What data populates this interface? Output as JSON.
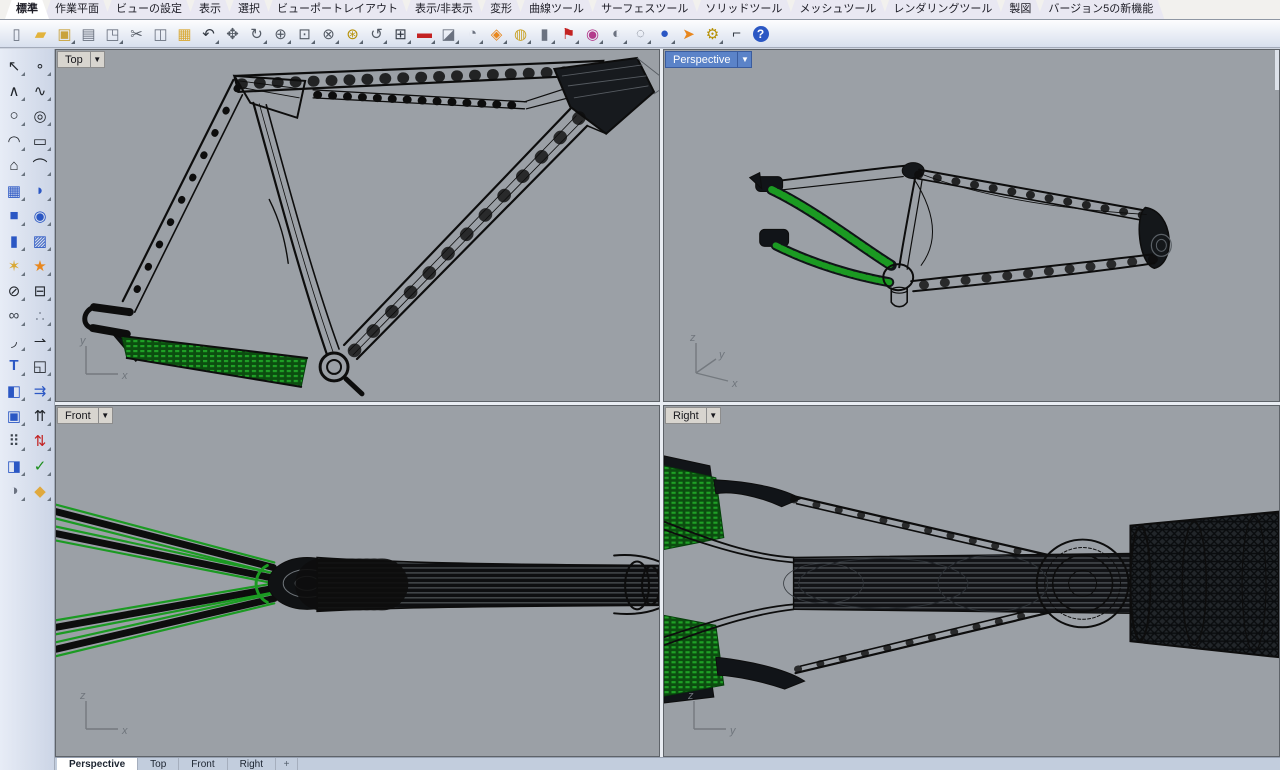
{
  "app": {
    "name_hint": "Rhinoceros 4-viewport modeling window"
  },
  "colors": {
    "viewport_bg": "#9ba0a6",
    "wireframe": "#0d0d0d",
    "selection_green": "#1b9a22",
    "selection_green_dark": "#0c4d10",
    "active_label_bg": "#5b83c8",
    "inactive_label_bg": "#d8d5cf",
    "toolbar_bg": "#d8e0ee"
  },
  "menu_tabs": {
    "items": [
      {
        "name": "standard",
        "label": "標準",
        "active": true
      },
      {
        "name": "cplane",
        "label": "作業平面",
        "active": false
      },
      {
        "name": "view-settings",
        "label": "ビューの設定",
        "active": false
      },
      {
        "name": "display",
        "label": "表示",
        "active": false
      },
      {
        "name": "select",
        "label": "選択",
        "active": false
      },
      {
        "name": "viewport-layout",
        "label": "ビューポートレイアウト",
        "active": false
      },
      {
        "name": "visibility",
        "label": "表示/非表示",
        "active": false
      },
      {
        "name": "transform",
        "label": "変形",
        "active": false
      },
      {
        "name": "curve-tools",
        "label": "曲線ツール",
        "active": false
      },
      {
        "name": "surface-tools",
        "label": "サーフェスツール",
        "active": false
      },
      {
        "name": "solid-tools",
        "label": "ソリッドツール",
        "active": false
      },
      {
        "name": "mesh-tools",
        "label": "メッシュツール",
        "active": false
      },
      {
        "name": "render-tools",
        "label": "レンダリングツール",
        "active": false
      },
      {
        "name": "drafting",
        "label": "製図",
        "active": false
      },
      {
        "name": "v5-new-features",
        "label": "バージョン5の新機能",
        "active": false
      }
    ]
  },
  "toolbar": {
    "icons": [
      {
        "name": "new-file-icon",
        "glyph": "▯",
        "color": "#6b7280",
        "fly": false
      },
      {
        "name": "open-file-icon",
        "glyph": "▰",
        "color": "#e2b33c",
        "fly": false
      },
      {
        "name": "save-icon",
        "glyph": "▣",
        "color": "#c9a23a",
        "fly": true
      },
      {
        "name": "print-icon",
        "glyph": "▤",
        "color": "#6b7280",
        "fly": false
      },
      {
        "name": "export-file-icon",
        "glyph": "◳",
        "color": "#6b7280",
        "fly": true
      },
      {
        "name": "cut-icon",
        "glyph": "✂",
        "color": "#555c66",
        "fly": false
      },
      {
        "name": "copy-icon",
        "glyph": "◫",
        "color": "#6b7280",
        "fly": false
      },
      {
        "name": "paste-icon",
        "glyph": "▦",
        "color": "#d9a832",
        "fly": false
      },
      {
        "name": "undo-icon",
        "glyph": "↶",
        "color": "#333a44",
        "fly": true
      },
      {
        "name": "pan-icon",
        "glyph": "✥",
        "color": "#555c66",
        "fly": false
      },
      {
        "name": "rotate-view-icon",
        "glyph": "↻",
        "color": "#555c66",
        "fly": true
      },
      {
        "name": "zoom-in-icon",
        "glyph": "⊕",
        "color": "#555c66",
        "fly": true
      },
      {
        "name": "zoom-window-icon",
        "glyph": "⊡",
        "color": "#555c66",
        "fly": true
      },
      {
        "name": "zoom-extents-icon",
        "glyph": "⊗",
        "color": "#555c66",
        "fly": true
      },
      {
        "name": "zoom-selected-icon",
        "glyph": "⊛",
        "color": "#b58f00",
        "fly": true
      },
      {
        "name": "undo-view-icon",
        "glyph": "↺",
        "color": "#555c66",
        "fly": true
      },
      {
        "name": "viewport-layout-icon",
        "glyph": "⊞",
        "color": "#333a44",
        "fly": true
      },
      {
        "name": "car-icon",
        "glyph": "▬",
        "color": "#c32222",
        "fly": true
      },
      {
        "name": "map-icon",
        "glyph": "◪",
        "color": "#6b7280",
        "fly": true
      },
      {
        "name": "dial-icon",
        "glyph": "◔",
        "color": "#6b7280",
        "fly": true
      },
      {
        "name": "osnap-icon",
        "glyph": "◈",
        "color": "#e8871e",
        "fly": true
      },
      {
        "name": "lightbulb-icon",
        "glyph": "◍",
        "color": "#c9a227",
        "fly": true
      },
      {
        "name": "lock-icon",
        "glyph": "▮",
        "color": "#6b7280",
        "fly": true
      },
      {
        "name": "pennant-icon",
        "glyph": "⚑",
        "color": "#c32222",
        "fly": true
      },
      {
        "name": "color-wheel-icon",
        "glyph": "◉",
        "color": "#b33b8c",
        "fly": true
      },
      {
        "name": "shaded-sphere-icon",
        "glyph": "◐",
        "color": "#6b7280",
        "fly": true
      },
      {
        "name": "ghosted-sphere-icon",
        "glyph": "◌",
        "color": "#6b7280",
        "fly": true
      },
      {
        "name": "rendered-sphere-icon",
        "glyph": "●",
        "color": "#2b57c4",
        "fly": true
      },
      {
        "name": "cone-icon",
        "glyph": "➤",
        "color": "#e8871e",
        "fly": false
      },
      {
        "name": "gears-icon",
        "glyph": "⚙",
        "color": "#b58f00",
        "fly": true
      },
      {
        "name": "history-icon",
        "glyph": "⌐",
        "color": "#333a44",
        "fly": false
      },
      {
        "name": "help-icon",
        "glyph": "?",
        "color": "#ffffff",
        "fly": false,
        "round": true
      }
    ]
  },
  "sidebar": {
    "icons": [
      {
        "name": "select-arrow-icon",
        "glyph": "↖",
        "color": "#22262c"
      },
      {
        "name": "point-icon",
        "glyph": "∘",
        "color": "#22262c"
      },
      {
        "name": "polyline-icon",
        "glyph": "∧",
        "color": "#22262c"
      },
      {
        "name": "curve-icon",
        "glyph": "∿",
        "color": "#22262c"
      },
      {
        "name": "circle-icon",
        "glyph": "○",
        "color": "#22262c"
      },
      {
        "name": "ellipse-icon",
        "glyph": "◎",
        "color": "#22262c"
      },
      {
        "name": "arc-icon",
        "glyph": "◠",
        "color": "#22262c"
      },
      {
        "name": "rectangle-icon",
        "glyph": "▭",
        "color": "#22262c"
      },
      {
        "name": "polygon-icon",
        "glyph": "⌂",
        "color": "#22262c"
      },
      {
        "name": "handle-curve-icon",
        "glyph": "⌒",
        "color": "#22262c"
      },
      {
        "name": "surface-points-icon",
        "glyph": "▦",
        "color": "#2b57c4"
      },
      {
        "name": "curved-surface-icon",
        "glyph": "◗",
        "color": "#2b57c4"
      },
      {
        "name": "box-icon",
        "glyph": "■",
        "color": "#2b57c4"
      },
      {
        "name": "spheres-icon",
        "glyph": "◉",
        "color": "#2b57c4"
      },
      {
        "name": "cylinder-icon",
        "glyph": "▮",
        "color": "#2b57c4"
      },
      {
        "name": "mesh-plane-icon",
        "glyph": "▨",
        "color": "#2b57c4"
      },
      {
        "name": "boolean-union-icon",
        "glyph": "✶",
        "color": "#d9a832"
      },
      {
        "name": "explode-icon",
        "glyph": "★",
        "color": "#e8871e"
      },
      {
        "name": "trim-icon",
        "glyph": "⊘",
        "color": "#22262c"
      },
      {
        "name": "split-icon",
        "glyph": "⊟",
        "color": "#22262c"
      },
      {
        "name": "join-icon",
        "glyph": "∞",
        "color": "#3c434c"
      },
      {
        "name": "group-icon",
        "glyph": "∴",
        "color": "#8a93a3"
      },
      {
        "name": "fillet-curve-icon",
        "glyph": "◞",
        "color": "#22262c"
      },
      {
        "name": "extend-curve-icon",
        "glyph": "⇀",
        "color": "#22262c"
      },
      {
        "name": "text-icon",
        "glyph": "T",
        "color": "#2b57c4",
        "bold": true
      },
      {
        "name": "point-edit-icon",
        "glyph": "◱",
        "color": "#22262c"
      },
      {
        "name": "blocks-icon",
        "glyph": "◧",
        "color": "#2b57c4"
      },
      {
        "name": "offset-icon",
        "glyph": "⇉",
        "color": "#2b57c4"
      },
      {
        "name": "solid-box-icon",
        "glyph": "▣",
        "color": "#2b57c4"
      },
      {
        "name": "extrude-icon",
        "glyph": "⇈",
        "color": "#22262c"
      },
      {
        "name": "array-icon",
        "glyph": "⠿",
        "color": "#3c434c"
      },
      {
        "name": "axis-align-icon",
        "glyph": "⇅",
        "color": "#c32222"
      },
      {
        "name": "mirror-icon",
        "glyph": "◨",
        "color": "#2b57c4"
      },
      {
        "name": "check-icon",
        "glyph": "✓",
        "color": "#1e8f1e"
      },
      {
        "name": "boolean-diff-icon",
        "glyph": "◑",
        "color": "#6b7280"
      },
      {
        "name": "gumball-icon",
        "glyph": "◆",
        "color": "#e0a93e"
      }
    ]
  },
  "viewports": {
    "caret": "▼",
    "top": {
      "label": "Top",
      "active": false,
      "axis": {
        "v": "y",
        "h": "x"
      }
    },
    "perspective": {
      "label": "Perspective",
      "active": true,
      "axis": {
        "v": "z",
        "mid": "y",
        "h": "x"
      }
    },
    "front": {
      "label": "Front",
      "active": false,
      "axis": {
        "v": "z",
        "h": "x"
      }
    },
    "right": {
      "label": "Right",
      "active": false,
      "axis": {
        "v": "z",
        "h": "y"
      }
    }
  },
  "bottom_tabs": {
    "items": [
      {
        "name": "perspective",
        "label": "Perspective",
        "active": true
      },
      {
        "name": "top",
        "label": "Top",
        "active": false
      },
      {
        "name": "front",
        "label": "Front",
        "active": false
      },
      {
        "name": "right",
        "label": "Right",
        "active": false
      }
    ],
    "add_label": "+"
  }
}
